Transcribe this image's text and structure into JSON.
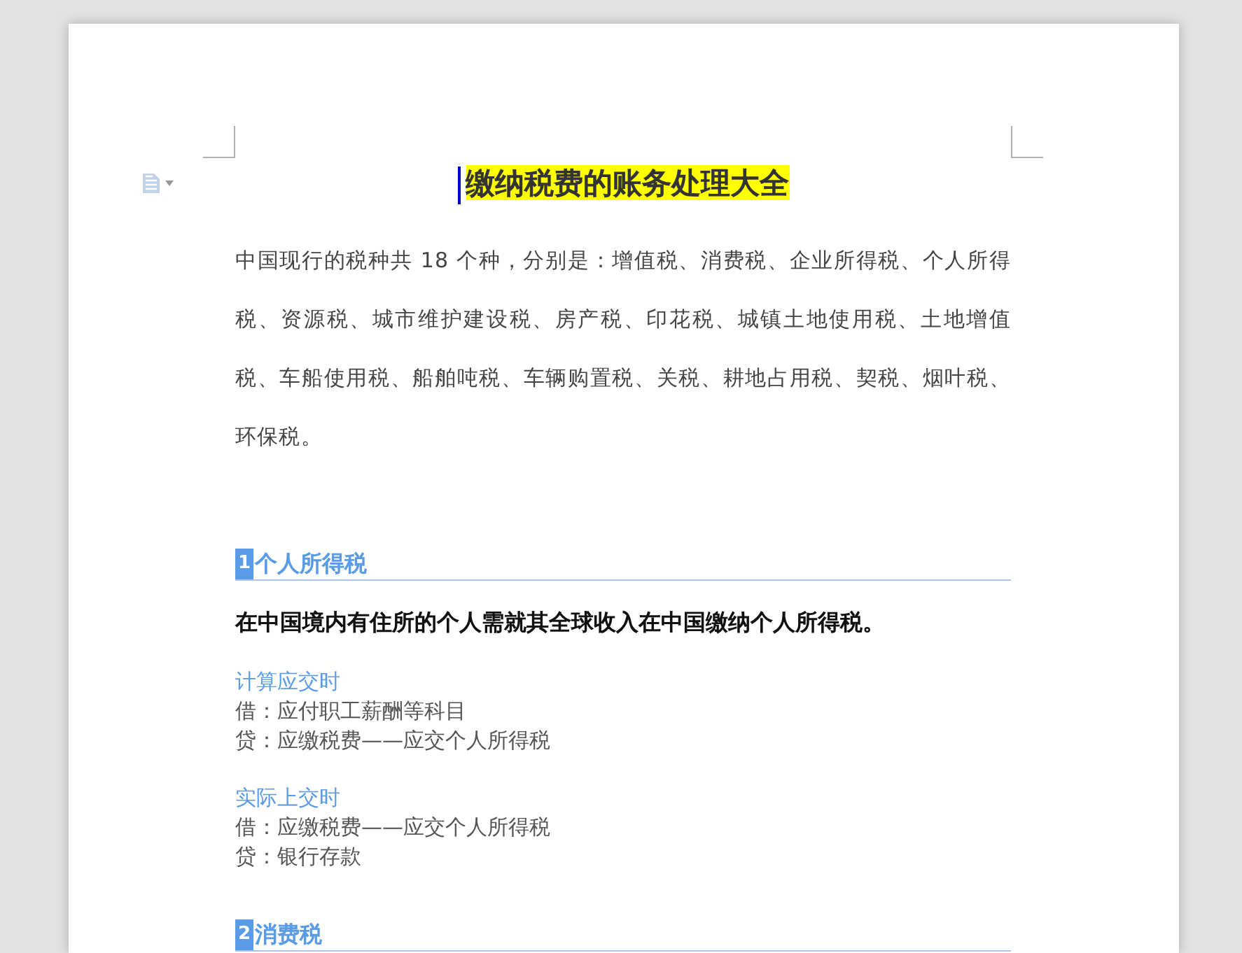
{
  "document": {
    "title": {
      "text": "缴纳税费的账务处理大全",
      "highlighted": true
    },
    "intro": "中国现行的税种共 18 个种，分别是：增值税、消费税、企业所得税、个人所得税、资源税、城市维护建设税、房产税、印花税、城镇土地使用税、土地增值税、车船使用税、船舶吨税、车辆购置税、关税、耕地占用税、契税、烟叶税、环保税。",
    "sections": [
      {
        "number": "1",
        "heading": "个人所得税",
        "lead": "在中国境内有住所的个人需就其全球收入在中国缴纳个人所得税。",
        "groups": [
          {
            "label": "计算应交时",
            "lines": [
              "借：应付职工薪酬等科目",
              "贷：应缴税费——应交个人所得税"
            ]
          },
          {
            "label": "实际上交时",
            "lines": [
              "借：应缴税费——应交个人所得税",
              "贷：银行存款"
            ]
          }
        ]
      },
      {
        "number": "2",
        "heading": "消费税"
      }
    ]
  }
}
